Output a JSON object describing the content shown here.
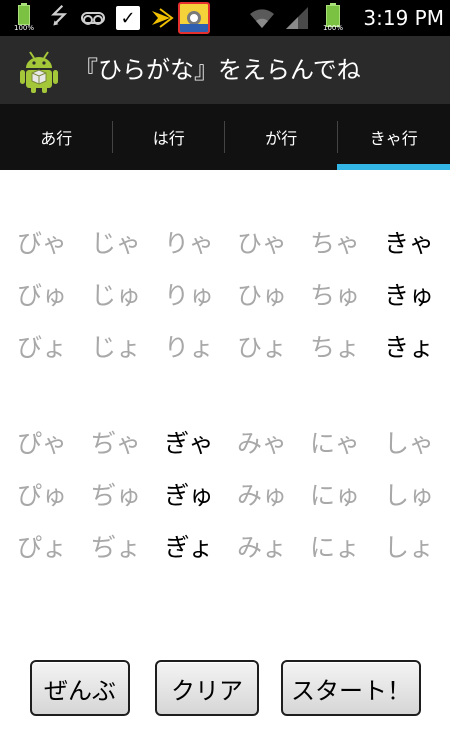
{
  "status_bar": {
    "battery_small_label": "100%",
    "battery_large_label": "100%",
    "time": "3:19 PM",
    "icons": [
      "battery-icon",
      "usb-icon",
      "voicemail-icon",
      "check-bag-icon",
      "sprint-icon",
      "minion-app-icon",
      "wifi-icon",
      "signal-icon",
      "battery-icon"
    ]
  },
  "action_bar": {
    "title": "『ひらがな』をえらんでね",
    "icon": "android-app-icon"
  },
  "tabs": [
    {
      "label": "あ行",
      "selected": false
    },
    {
      "label": "は行",
      "selected": false
    },
    {
      "label": "が行",
      "selected": false
    },
    {
      "label": "きゃ行",
      "selected": true
    }
  ],
  "groups": [
    [
      [
        {
          "t": "びゃ",
          "on": false
        },
        {
          "t": "じゃ",
          "on": false
        },
        {
          "t": "りゃ",
          "on": false
        },
        {
          "t": "ひゃ",
          "on": false
        },
        {
          "t": "ちゃ",
          "on": false
        },
        {
          "t": "きゃ",
          "on": true
        }
      ],
      [
        {
          "t": "びゅ",
          "on": false
        },
        {
          "t": "じゅ",
          "on": false
        },
        {
          "t": "りゅ",
          "on": false
        },
        {
          "t": "ひゅ",
          "on": false
        },
        {
          "t": "ちゅ",
          "on": false
        },
        {
          "t": "きゅ",
          "on": true
        }
      ],
      [
        {
          "t": "びょ",
          "on": false
        },
        {
          "t": "じょ",
          "on": false
        },
        {
          "t": "りょ",
          "on": false
        },
        {
          "t": "ひょ",
          "on": false
        },
        {
          "t": "ちょ",
          "on": false
        },
        {
          "t": "きょ",
          "on": true
        }
      ]
    ],
    [
      [
        {
          "t": "ぴゃ",
          "on": false
        },
        {
          "t": "ぢゃ",
          "on": false
        },
        {
          "t": "ぎゃ",
          "on": true
        },
        {
          "t": "みゃ",
          "on": false
        },
        {
          "t": "にゃ",
          "on": false
        },
        {
          "t": "しゃ",
          "on": false
        }
      ],
      [
        {
          "t": "ぴゅ",
          "on": false
        },
        {
          "t": "ぢゅ",
          "on": false
        },
        {
          "t": "ぎゅ",
          "on": true
        },
        {
          "t": "みゅ",
          "on": false
        },
        {
          "t": "にゅ",
          "on": false
        },
        {
          "t": "しゅ",
          "on": false
        }
      ],
      [
        {
          "t": "ぴょ",
          "on": false
        },
        {
          "t": "ぢょ",
          "on": false
        },
        {
          "t": "ぎょ",
          "on": true
        },
        {
          "t": "みょ",
          "on": false
        },
        {
          "t": "にょ",
          "on": false
        },
        {
          "t": "しょ",
          "on": false
        }
      ]
    ]
  ],
  "buttons": {
    "all_label": "ぜんぶ",
    "clear_label": "クリア",
    "start_label": "スタート！"
  },
  "colors": {
    "selected_kana": "#000000",
    "unselected_kana": "#a8a8a8",
    "tab_indicator": "#33b5e5",
    "action_bar_bg": "#2a2a2a",
    "tab_bar_bg": "#111111"
  }
}
